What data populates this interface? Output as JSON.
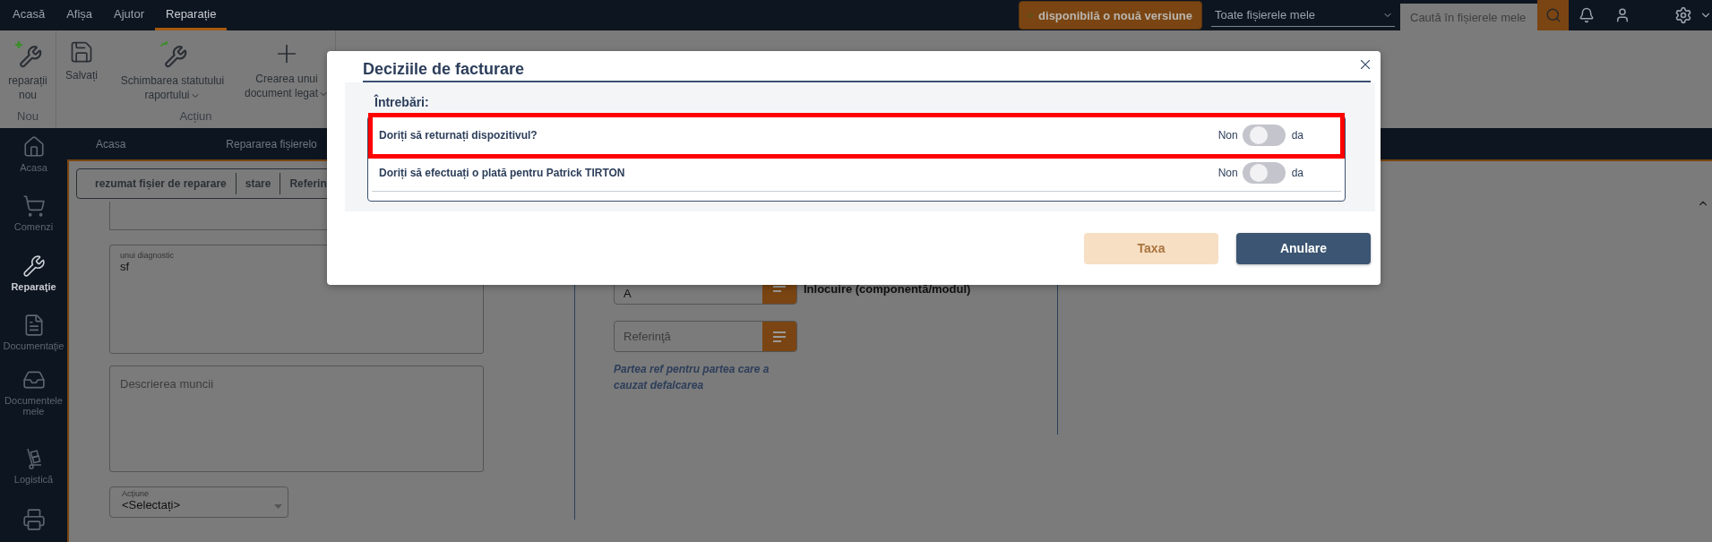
{
  "top_bar": {
    "menu": [
      {
        "label": "Acasă",
        "selected": false
      },
      {
        "label": "Afișa",
        "selected": false
      },
      {
        "label": "Ajutor",
        "selected": false
      },
      {
        "label": "Reparație",
        "selected": true
      }
    ],
    "update_button": "disponibilă o nouă versiune",
    "file_scope": "Toate fișierele mele",
    "search": {
      "placeholder": "Caută în fișierele mele"
    }
  },
  "toolbar": {
    "groups": [
      {
        "label": "Nou",
        "items": [
          {
            "label": "reparații nou",
            "has_menu": false
          }
        ]
      },
      {
        "label": "Acțiun",
        "items": [
          {
            "label": "Salvați",
            "has_menu": false
          },
          {
            "label": "Schimbarea statutului raportului",
            "has_menu": true
          },
          {
            "label": "Crearea unui document legat",
            "has_menu": true
          }
        ]
      }
    ]
  },
  "sidebar": {
    "items": [
      {
        "label": "Acasa",
        "selected": false
      },
      {
        "label": "Comenzi",
        "selected": false
      },
      {
        "label": "Reparaţie",
        "selected": true
      },
      {
        "label": "Documentaţie",
        "selected": false
      },
      {
        "label": "Documentele mele",
        "selected": false
      },
      {
        "label": "Logistică",
        "selected": false
      },
      {
        "selected": false
      }
    ]
  },
  "breadcrumb": [
    "Acasa",
    "Repararea fișierelo"
  ],
  "tabs": [
    "rezumat fișier de reparare",
    "stare",
    "Referin"
  ],
  "form": {
    "diagnostic": {
      "label": "unui diagnostic",
      "value": "sf"
    },
    "work_description": {
      "placeholder": "Descrierea muncii"
    },
    "action": {
      "label": "Acțiune",
      "value": "<Selectați>"
    }
  },
  "part": {
    "code_value": "A",
    "description": "Inlocuire (componentă/modul)",
    "reference": {
      "placeholder": "Referinţă"
    },
    "hint": "Partea ref pentru partea care a cauzat defalcarea"
  },
  "dialog": {
    "title": "Deciziile de facturare",
    "section_label": "Întrebări:",
    "questions": [
      {
        "text": "Doriți să returnați dispozitivul?",
        "no_label": "Non",
        "yes_label": "da",
        "on": false,
        "highlighted": true
      },
      {
        "text": "Doriți să efectuați o plată pentru Patrick TIRTON",
        "no_label": "Non",
        "yes_label": "da",
        "on": false,
        "highlighted": false
      }
    ],
    "buttons": [
      {
        "label": "Taxa",
        "kind": "primary",
        "disabled": true
      },
      {
        "label": "Anulare",
        "kind": "secondary"
      }
    ]
  }
}
